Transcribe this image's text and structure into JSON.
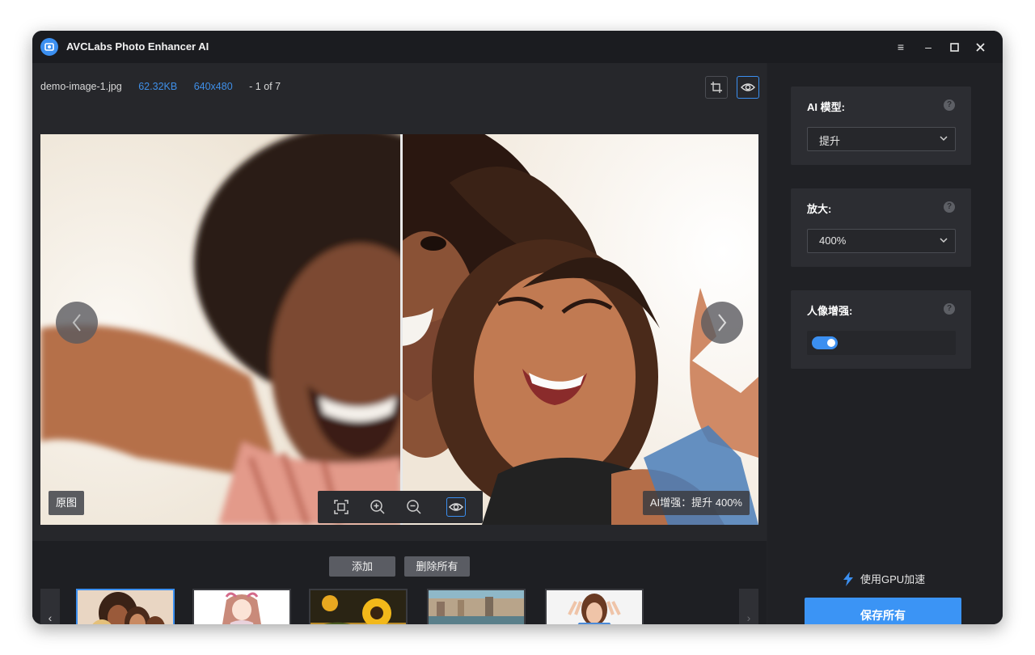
{
  "app": {
    "title": "AVCLabs Photo Enhancer AI"
  },
  "window_controls": {
    "menu": "≡",
    "minimize": "–",
    "maximize": "☐",
    "close": "✕"
  },
  "file_info": {
    "name": "demo-image-1.jpg",
    "size": "62.32KB",
    "resolution": "640x480",
    "position": "- 1 of 7"
  },
  "viewer": {
    "original_label": "原图",
    "ai_label": "AI增强：提升 400%"
  },
  "bottom": {
    "add_label": "添加",
    "delete_all_label": "删除所有",
    "prev": "‹",
    "next": "›",
    "thumbnails": [
      {
        "name": "thumb-selfie-friends",
        "selected": true
      },
      {
        "name": "thumb-anime-girl",
        "selected": false
      },
      {
        "name": "thumb-sunflower",
        "selected": false
      },
      {
        "name": "thumb-venice-canal",
        "selected": false
      },
      {
        "name": "thumb-woman-peace-sign",
        "selected": false
      }
    ]
  },
  "settings": {
    "ai_model": {
      "label": "AI 模型:",
      "value": "提升"
    },
    "upscale": {
      "label": "放大:",
      "value": "400%"
    },
    "face_enhance": {
      "label": "人像增强:",
      "enabled": true
    },
    "help": "?"
  },
  "footer": {
    "gpu_label": "使用GPU加速",
    "save_all_label": "保存所有"
  },
  "colors": {
    "accent": "#3b8ff0",
    "bg": "#232428",
    "panel": "#2c2d32"
  }
}
